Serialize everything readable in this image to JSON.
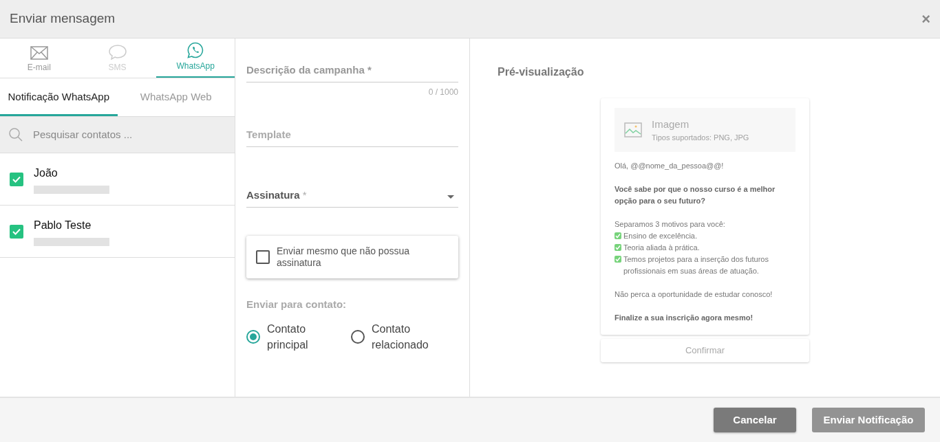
{
  "dialog": {
    "title": "Enviar mensagem",
    "close": "×"
  },
  "channels": [
    {
      "label": "E-mail",
      "kind": "email",
      "selected": false,
      "disabled": false
    },
    {
      "label": "SMS",
      "kind": "sms",
      "selected": false,
      "disabled": true
    },
    {
      "label": "WhatsApp",
      "kind": "whatsapp",
      "selected": true,
      "disabled": false
    }
  ],
  "subtabs": [
    {
      "label": "Notificação WhatsApp",
      "selected": true
    },
    {
      "label": "WhatsApp Web",
      "selected": false
    }
  ],
  "search": {
    "placeholder": "Pesquisar contatos ..."
  },
  "contacts": [
    {
      "name": "João",
      "checked": true
    },
    {
      "name": "Pablo Teste",
      "checked": true
    }
  ],
  "form": {
    "description": {
      "label": "Descrição da campanha",
      "required": "*",
      "counter": "0 / 1000"
    },
    "template": {
      "label": "Template"
    },
    "signature": {
      "label": "Assinatura",
      "required": "*"
    },
    "no_signature": {
      "label": "Enviar mesmo que não possua assinatura",
      "checked": false
    },
    "send_to": {
      "label": "Enviar para contato:",
      "options": [
        {
          "label": "Contato principal",
          "selected": true
        },
        {
          "label": "Contato relacionado",
          "selected": false
        }
      ]
    }
  },
  "preview": {
    "title": "Pré-visualização",
    "image": {
      "label": "Imagem",
      "hint": "Tipos suportados: PNG, JPG"
    },
    "lines": [
      {
        "kind": "text",
        "text": "Olá, @@nome_da_pessoa@@!"
      },
      {
        "kind": "blank"
      },
      {
        "kind": "bold",
        "text": "Você sabe por que o nosso curso é a melhor opção para o seu futuro?"
      },
      {
        "kind": "blank"
      },
      {
        "kind": "text",
        "text": "Separamos 3 motivos para você:"
      },
      {
        "kind": "check",
        "text": "Ensino de excelência."
      },
      {
        "kind": "check",
        "text": "Teoria aliada à prática."
      },
      {
        "kind": "check",
        "text": "Temos projetos para a inserção dos futuros profissionais em suas áreas de atuação."
      },
      {
        "kind": "blank"
      },
      {
        "kind": "text",
        "text": "Não perca a oportunidade de estudar conosco!"
      },
      {
        "kind": "blank"
      },
      {
        "kind": "bold",
        "text": "Finalize a sua inscrição agora mesmo!"
      }
    ],
    "confirm": "Confirmar"
  },
  "footer": {
    "cancel": "Cancelar",
    "send": {
      "label": "Enviar Notificação",
      "disabled": true
    }
  }
}
